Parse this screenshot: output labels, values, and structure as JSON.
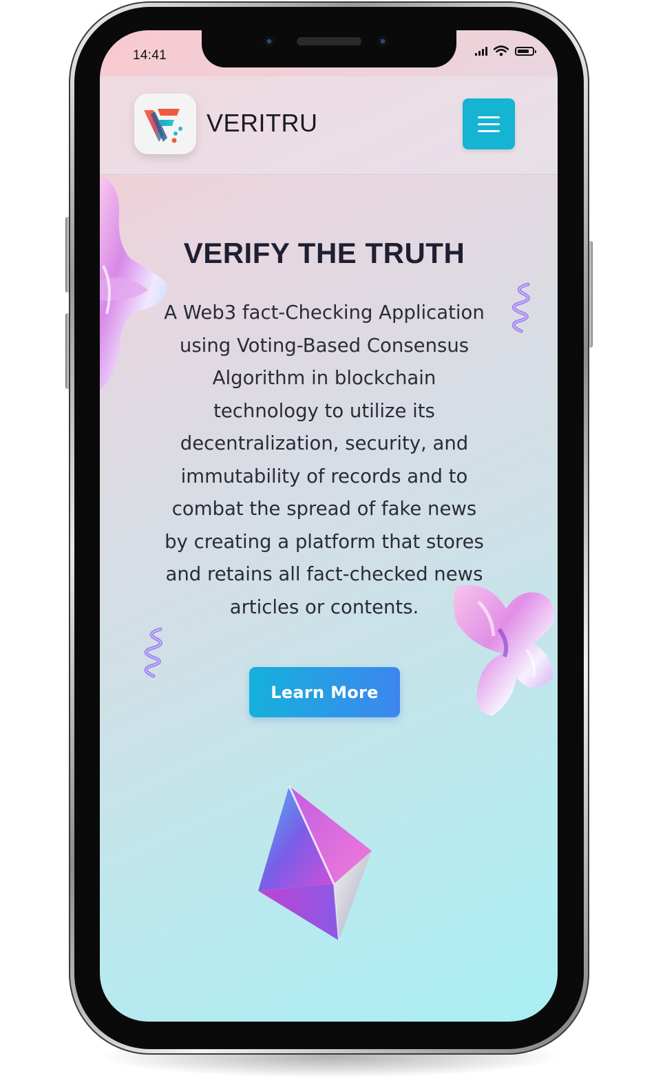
{
  "status_bar": {
    "time": "14:41"
  },
  "header": {
    "brand": "VERITRU",
    "menu_icon": "hamburger-menu-icon",
    "menu_color": "#14b4d2"
  },
  "hero": {
    "title": "VERIFY THE TRUTH",
    "lines": [
      "A Web3 fact-Checking Application",
      "using Voting-Based Consensus",
      "Algorithm in blockchain",
      "technology to utilize its",
      "decentralization, security, and",
      "immutability of records and to",
      "combat the spread of fake news",
      "by creating a platform that stores",
      "and retains all fact-checked news",
      "articles or contents."
    ],
    "button_label": "Learn More"
  }
}
